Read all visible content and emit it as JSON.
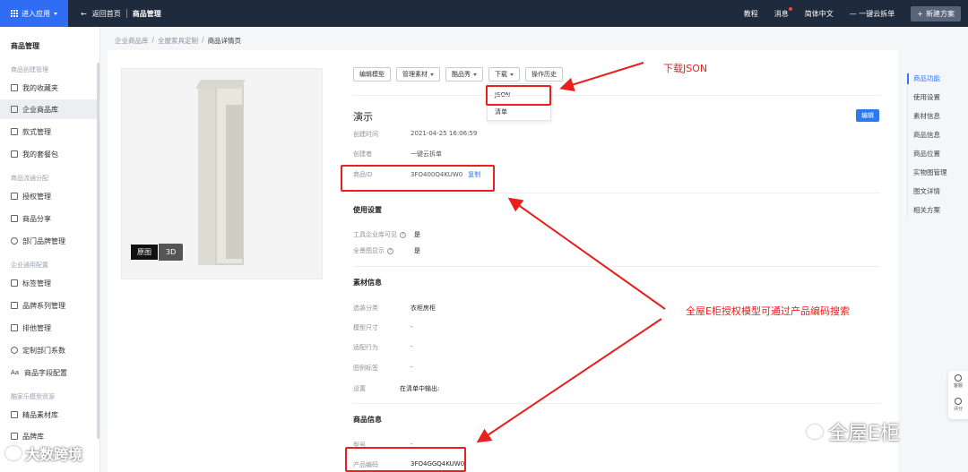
{
  "topbar": {
    "enter_app": "进入应用",
    "back": "返回首页",
    "section": "商品管理",
    "links": [
      "教程",
      "消息",
      "简体中文",
      "一键云拆单"
    ],
    "new_plan": "新建方案"
  },
  "sidebar": {
    "title": "商品管理",
    "groups": [
      "商品创建管理",
      "商品流通分配",
      "企业通用配置",
      "酷家乐模型资源"
    ],
    "items": [
      "我的收藏夹",
      "企业商品库",
      "款式管理",
      "我的套餐包",
      "授权管理",
      "商品分享",
      "部门品牌管理",
      "标签管理",
      "品牌系列管理",
      "排他管理",
      "定制部门系数",
      "商品字段配置",
      "精品素材库",
      "品牌库"
    ],
    "active_index": 1
  },
  "breadcrumb": [
    "企业商品库",
    "全屋家具定制",
    "商品详情页"
  ],
  "preview": {
    "toggle_original": "原图",
    "toggle_3d": "3D"
  },
  "toolbar": {
    "edit_model": "编辑模型",
    "manage_material": "管理素材",
    "recommend": "酷品秀",
    "download": "下载",
    "history": "操作历史",
    "download_menu": [
      "JSON",
      "清单"
    ]
  },
  "product": {
    "name": "演示",
    "edit": "编辑",
    "created_time_label": "创建时间",
    "created_time": "2021-04-25 16:06:59",
    "creator_label": "创建者",
    "creator": "一键云拆单",
    "id_label": "商品ID",
    "id": "3FO400Q4KUW0",
    "copy": "复制"
  },
  "usage": {
    "title": "使用设置",
    "rows": [
      {
        "label": "工具企业库可见",
        "value": "是"
      },
      {
        "label": "全景图显示",
        "value": "是"
      }
    ]
  },
  "material": {
    "title": "素材信息",
    "rows": [
      {
        "label": "选装分类",
        "value": "衣柜房柜"
      },
      {
        "label": "模型尺寸",
        "value": "-"
      },
      {
        "label": "适配行为",
        "value": "-"
      },
      {
        "label": "图例标签",
        "value": "-"
      },
      {
        "label": "设置",
        "value": "在清单中输出:"
      }
    ]
  },
  "goods": {
    "title": "商品信息",
    "rows": [
      {
        "label": "型号",
        "value": "-"
      },
      {
        "label": "产品编码",
        "value": "3FO4GGQ4KUW0"
      }
    ]
  },
  "anchor_nav": [
    "商品功能",
    "使用设置",
    "素材信息",
    "商品信息",
    "商品位置",
    "实物图管理",
    "图文详情",
    "相关方案"
  ],
  "float_tools": [
    "客服",
    "评分"
  ],
  "annotations": {
    "download_json": "下载JSON",
    "search_tip": "全屋E柜授权模型可通过产品编码搜索"
  },
  "watermarks": {
    "left": "大数跨境",
    "right": "全屋E柜"
  },
  "colors": {
    "accent": "#2f79ee",
    "annotation": "#e8201e",
    "topbar": "#1f2a3d"
  }
}
